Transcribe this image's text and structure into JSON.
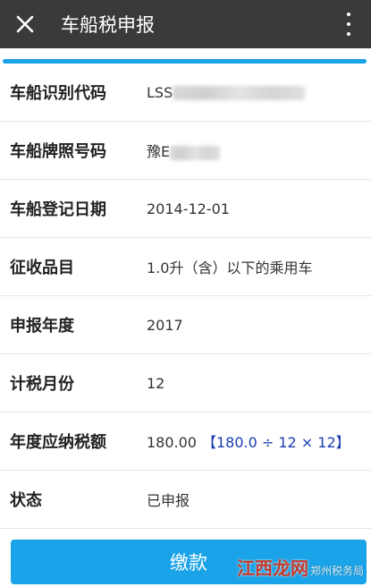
{
  "header": {
    "title": "车船税申报",
    "close_icon": "close-icon",
    "more_icon": "more-vertical-icon"
  },
  "rows": [
    {
      "label": "车船识别代码",
      "value": "LSS",
      "redacted": true
    },
    {
      "label": "车船牌照号码",
      "value": "豫E",
      "redacted": true
    },
    {
      "label": "车船登记日期",
      "value": "2014-12-01"
    },
    {
      "label": "征收品目",
      "value": "1.0升（含）以下的乘用车"
    },
    {
      "label": "申报年度",
      "value": "2017"
    },
    {
      "label": "计税月份",
      "value": "12"
    },
    {
      "label": "年度应纳税额",
      "value": "180.00",
      "formula": "【180.0 ÷ 12 × 12】"
    },
    {
      "label": "状态",
      "value": "已申报"
    }
  ],
  "pay_button": {
    "label": "缴款"
  },
  "watermark": {
    "brand": "江西龙网",
    "text": "郑州税务局"
  },
  "colors": {
    "titlebar": "#3a3a3a",
    "accent": "#1aa3e8",
    "formula": "#1a3db3"
  }
}
